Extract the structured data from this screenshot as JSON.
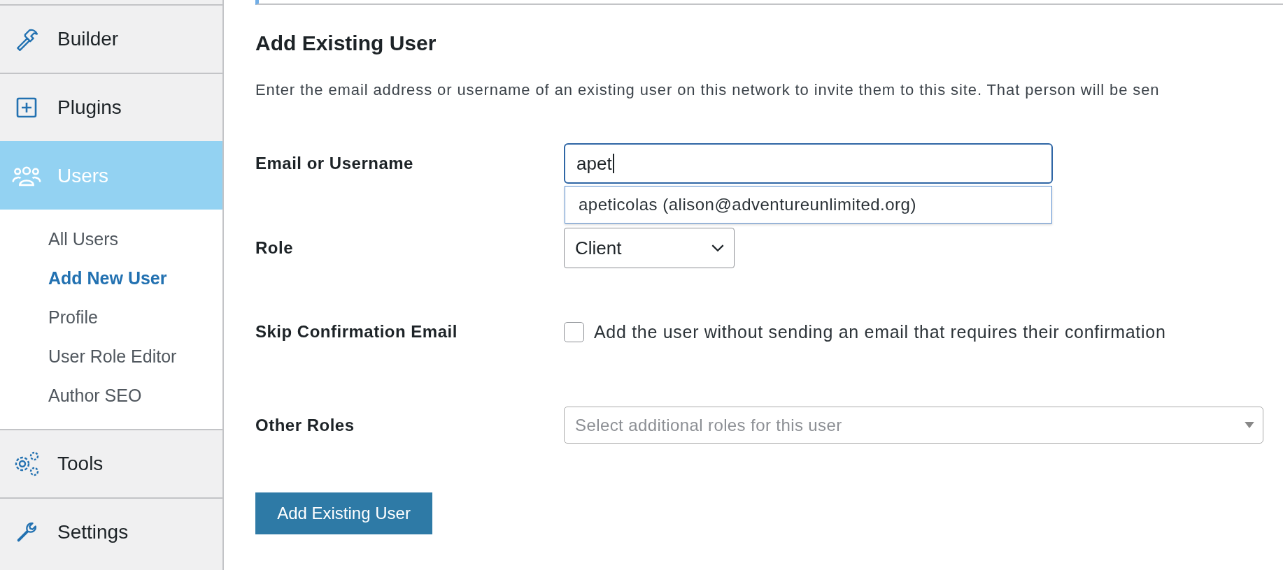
{
  "sidebar": {
    "items": [
      {
        "label": "Builder",
        "selected": false
      },
      {
        "label": "Plugins",
        "selected": false
      },
      {
        "label": "Users",
        "selected": true,
        "children": [
          {
            "label": "All Users",
            "selected": false
          },
          {
            "label": "Add New User",
            "selected": true
          },
          {
            "label": "Profile",
            "selected": false
          },
          {
            "label": "User Role Editor",
            "selected": false
          },
          {
            "label": "Author SEO",
            "selected": false
          }
        ]
      },
      {
        "label": "Tools",
        "selected": false
      },
      {
        "label": "Settings",
        "selected": false
      }
    ]
  },
  "main": {
    "title": "Add Existing User",
    "description": "Enter the email address or username of an existing user on this network to invite them to this site. That person will be sen",
    "fields": [
      {
        "kind": "text",
        "label": "Email or Username",
        "value": "apet",
        "suggestion": "apeticolas (alison@adventureunlimited.org)"
      },
      {
        "kind": "select",
        "label": "Role",
        "value": "Client"
      },
      {
        "kind": "checkbox",
        "label": "Skip Confirmation Email",
        "checked": false,
        "text": "Add the user without sending an email that requires their confirmation"
      },
      {
        "kind": "multiselect",
        "label": "Other Roles",
        "placeholder": "Select additional roles for this user"
      }
    ],
    "submit": "Add Existing User"
  }
}
